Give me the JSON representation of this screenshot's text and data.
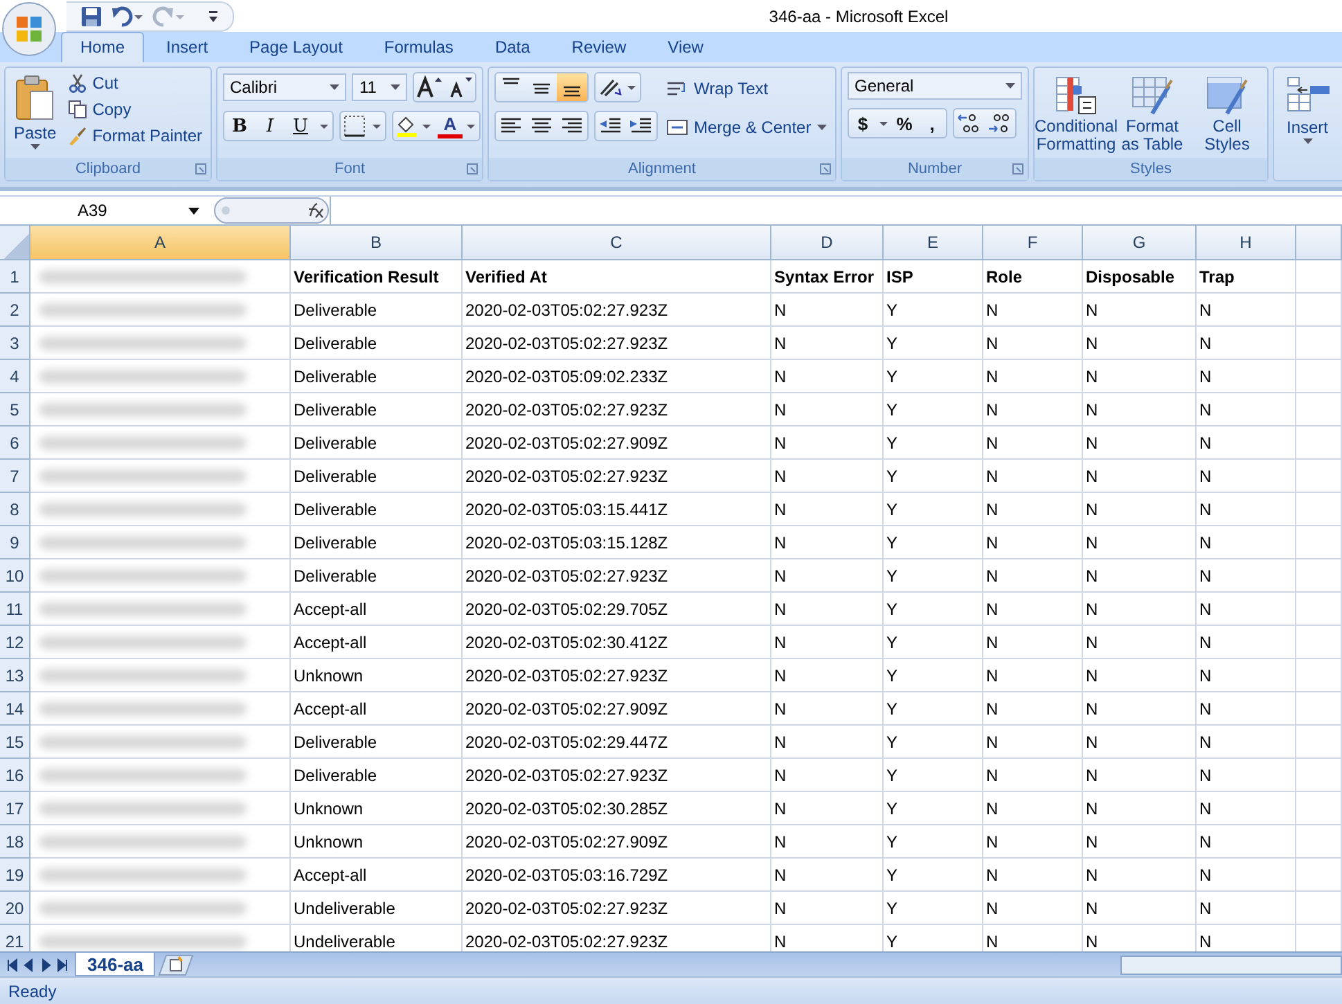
{
  "window": {
    "title": "346-aa - Microsoft Excel"
  },
  "tabs": [
    {
      "label": "Home",
      "selected": true
    },
    {
      "label": "Insert",
      "selected": false
    },
    {
      "label": "Page Layout",
      "selected": false
    },
    {
      "label": "Formulas",
      "selected": false
    },
    {
      "label": "Data",
      "selected": false
    },
    {
      "label": "Review",
      "selected": false
    },
    {
      "label": "View",
      "selected": false
    }
  ],
  "ribbon": {
    "clipboard": {
      "label": "Clipboard",
      "paste": "Paste",
      "cut": "Cut",
      "copy": "Copy",
      "format_painter": "Format Painter"
    },
    "font": {
      "label": "Font",
      "name": "Calibri",
      "size": "11",
      "bold": "B",
      "italic": "I",
      "underline": "U",
      "font_color": "A"
    },
    "alignment": {
      "label": "Alignment",
      "vertical": [
        {
          "selected": false
        },
        {
          "selected": false
        },
        {
          "selected": true
        }
      ],
      "wrap_text": "Wrap Text",
      "merge_center": "Merge & Center"
    },
    "number": {
      "label": "Number",
      "format": "General",
      "currency": "$",
      "percent": "%",
      "comma": ","
    },
    "styles": {
      "label": "Styles",
      "conditional": "Conditional Formatting",
      "format_table": "Format as Table",
      "cell_styles": "Cell Styles"
    },
    "cells": {
      "insert": "Insert"
    }
  },
  "name_box": "A39",
  "sheet": {
    "column_a_redacted": true,
    "columns": [
      "A",
      "B",
      "C",
      "D",
      "E",
      "F",
      "G",
      "H"
    ],
    "rows": [
      {
        "header": "1",
        "bold": true,
        "cells": [
          "",
          "Verification Result",
          "Verified At",
          "Syntax Error",
          "ISP",
          "Role",
          "Disposable",
          "Trap"
        ]
      },
      {
        "header": "2",
        "bold": false,
        "cells": [
          "",
          "Deliverable",
          "2020-02-03T05:02:27.923Z",
          "N",
          "Y",
          "N",
          "N",
          "N"
        ]
      },
      {
        "header": "3",
        "bold": false,
        "cells": [
          "",
          "Deliverable",
          "2020-02-03T05:02:27.923Z",
          "N",
          "Y",
          "N",
          "N",
          "N"
        ]
      },
      {
        "header": "4",
        "bold": false,
        "cells": [
          "",
          "Deliverable",
          "2020-02-03T05:09:02.233Z",
          "N",
          "Y",
          "N",
          "N",
          "N"
        ]
      },
      {
        "header": "5",
        "bold": false,
        "cells": [
          "",
          "Deliverable",
          "2020-02-03T05:02:27.923Z",
          "N",
          "Y",
          "N",
          "N",
          "N"
        ]
      },
      {
        "header": "6",
        "bold": false,
        "cells": [
          "",
          "Deliverable",
          "2020-02-03T05:02:27.909Z",
          "N",
          "Y",
          "N",
          "N",
          "N"
        ]
      },
      {
        "header": "7",
        "bold": false,
        "cells": [
          "",
          "Deliverable",
          "2020-02-03T05:02:27.923Z",
          "N",
          "Y",
          "N",
          "N",
          "N"
        ]
      },
      {
        "header": "8",
        "bold": false,
        "cells": [
          "",
          "Deliverable",
          "2020-02-03T05:03:15.441Z",
          "N",
          "Y",
          "N",
          "N",
          "N"
        ]
      },
      {
        "header": "9",
        "bold": false,
        "cells": [
          "",
          "Deliverable",
          "2020-02-03T05:03:15.128Z",
          "N",
          "Y",
          "N",
          "N",
          "N"
        ]
      },
      {
        "header": "10",
        "bold": false,
        "cells": [
          "",
          "Deliverable",
          "2020-02-03T05:02:27.923Z",
          "N",
          "Y",
          "N",
          "N",
          "N"
        ]
      },
      {
        "header": "11",
        "bold": false,
        "cells": [
          "",
          "Accept-all",
          "2020-02-03T05:02:29.705Z",
          "N",
          "Y",
          "N",
          "N",
          "N"
        ]
      },
      {
        "header": "12",
        "bold": false,
        "cells": [
          "",
          "Accept-all",
          "2020-02-03T05:02:30.412Z",
          "N",
          "Y",
          "N",
          "N",
          "N"
        ]
      },
      {
        "header": "13",
        "bold": false,
        "cells": [
          "",
          "Unknown",
          "2020-02-03T05:02:27.923Z",
          "N",
          "Y",
          "N",
          "N",
          "N"
        ]
      },
      {
        "header": "14",
        "bold": false,
        "cells": [
          "",
          "Accept-all",
          "2020-02-03T05:02:27.909Z",
          "N",
          "Y",
          "N",
          "N",
          "N"
        ]
      },
      {
        "header": "15",
        "bold": false,
        "cells": [
          "",
          "Deliverable",
          "2020-02-03T05:02:29.447Z",
          "N",
          "Y",
          "N",
          "N",
          "N"
        ]
      },
      {
        "header": "16",
        "bold": false,
        "cells": [
          "",
          "Deliverable",
          "2020-02-03T05:02:27.923Z",
          "N",
          "Y",
          "N",
          "N",
          "N"
        ]
      },
      {
        "header": "17",
        "bold": false,
        "cells": [
          "",
          "Unknown",
          "2020-02-03T05:02:30.285Z",
          "N",
          "Y",
          "N",
          "N",
          "N"
        ]
      },
      {
        "header": "18",
        "bold": false,
        "cells": [
          "",
          "Unknown",
          "2020-02-03T05:02:27.909Z",
          "N",
          "Y",
          "N",
          "N",
          "N"
        ]
      },
      {
        "header": "19",
        "bold": false,
        "cells": [
          "",
          "Accept-all",
          "2020-02-03T05:03:16.729Z",
          "N",
          "Y",
          "N",
          "N",
          "N"
        ]
      },
      {
        "header": "20",
        "bold": false,
        "cells": [
          "",
          "Undeliverable",
          "2020-02-03T05:02:27.923Z",
          "N",
          "Y",
          "N",
          "N",
          "N"
        ]
      },
      {
        "header": "21",
        "bold": false,
        "cells": [
          "",
          "Undeliverable",
          "2020-02-03T05:02:27.923Z",
          "N",
          "Y",
          "N",
          "N",
          "N"
        ]
      }
    ]
  },
  "sheet_tabs": [
    {
      "label": "346-aa",
      "selected": true
    }
  ],
  "status_bar": {
    "text": "Ready"
  }
}
